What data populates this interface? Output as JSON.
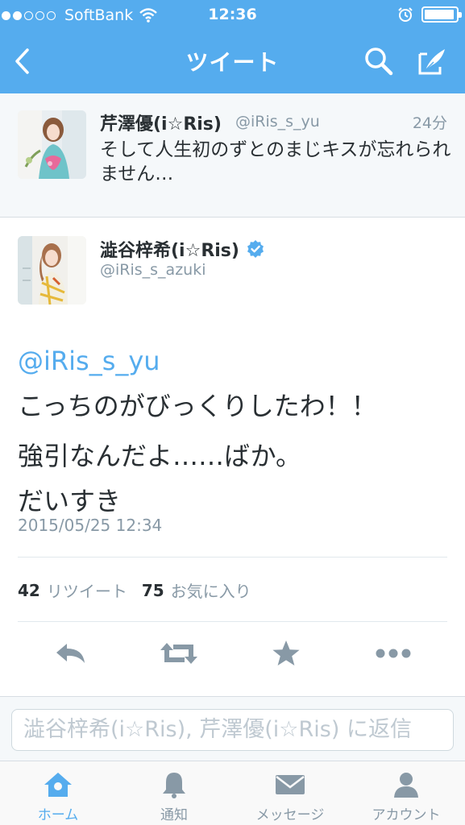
{
  "status_bar": {
    "carrier": "SoftBank",
    "signal_bars_filled": 2,
    "signal_bars_total": 5,
    "time": "12:36",
    "battery_level": 0.95
  },
  "nav": {
    "title": "ツイート",
    "back_icon": "chevron-left-icon",
    "search_icon": "search-icon",
    "compose_icon": "compose-icon"
  },
  "context_tweet": {
    "name": "芹澤優(i☆Ris)",
    "handle": "@iRis_s_yu",
    "time": "24分",
    "text": "そして人生初のずとのまじキスが忘れられません…"
  },
  "tweet": {
    "name": "澁谷梓希(i☆Ris)",
    "verified": true,
    "handle": "@iRis_s_azuki",
    "mention": "@iRis_s_yu",
    "line1": "こっちのがびっくりしたわ！！",
    "line2": "強引なんだよ……ばか。",
    "line3": "だいすき",
    "timestamp": "2015/05/25 12:34",
    "retweet_count": "42",
    "retweet_label": "リツイート",
    "favorite_count": "75",
    "favorite_label": "お気に入り"
  },
  "actions": [
    "reply-icon",
    "retweet-icon",
    "favorite-star-icon",
    "more-icon"
  ],
  "reply": {
    "placeholder": "澁谷梓希(i☆Ris), 芹澤優(i☆Ris) に返信"
  },
  "tabs": [
    {
      "label": "ホーム",
      "icon": "home-icon",
      "active": true
    },
    {
      "label": "通知",
      "icon": "bell-icon",
      "active": false
    },
    {
      "label": "メッセージ",
      "icon": "envelope-icon",
      "active": false
    },
    {
      "label": "アカウント",
      "icon": "person-icon",
      "active": false
    }
  ],
  "colors": {
    "brand": "#55acee",
    "text": "#292f33",
    "muted": "#8899a6",
    "verified": "#55acee"
  }
}
